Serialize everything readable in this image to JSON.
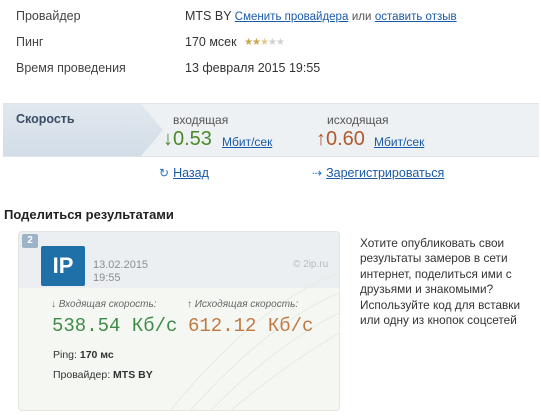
{
  "info": {
    "provider_label": "Провайдер",
    "provider_value": "MTS BY",
    "change_provider_link": "Сменить провайдера",
    "or_text": "или",
    "leave_review_link": "оставить отзыв",
    "ping_label": "Пинг",
    "ping_value": "170 мсек",
    "ping_rating": {
      "filled": 2.5,
      "total": 5
    },
    "time_label": "Время проведения",
    "time_value": "13 февраля 2015 19:55"
  },
  "speed": {
    "tab_label": "Скорость",
    "incoming_label": "входящая",
    "incoming_value": "0.53",
    "incoming_unit": "Мбит/сек",
    "outgoing_label": "исходящая",
    "outgoing_value": "0.60",
    "outgoing_unit": "Мбит/сек",
    "arrow_down": "↓",
    "arrow_up": "↑"
  },
  "nav": {
    "back_label": "Назад",
    "register_label": "Зарегистрироваться"
  },
  "share": {
    "title": "Поделиться результатами",
    "badge": "2",
    "description": "Хотите опубликовать свои результаты замеров в сети интернет, поделиться ими с друзьями и знакомыми? Используйте код для вставки или одну из кнопок соцсетей"
  },
  "card": {
    "logo": "IP",
    "date": "13.02.2015",
    "time": "19:55",
    "brand": "© 2ip.ru",
    "in_label": "↓ Входящая скорость:",
    "in_value": "538.54 Кб/с",
    "out_label": "↑ Исходящая скорость:",
    "out_value": "612.12 Кб/с",
    "ping_label": "Ping:",
    "ping_value": "170 мс",
    "provider_label": "Провайдер:",
    "provider_value": "MTS BY"
  },
  "colors": {
    "link": "#1a5aa6",
    "incoming": "#4a8a2a",
    "outgoing": "#b05a2c",
    "card_green": "#3f8a47",
    "card_orange": "#c27a45",
    "logo_bg": "#1f6fa8"
  },
  "icons": {
    "refresh": "refresh-icon",
    "arrow_right": "arrow-right-icon"
  }
}
